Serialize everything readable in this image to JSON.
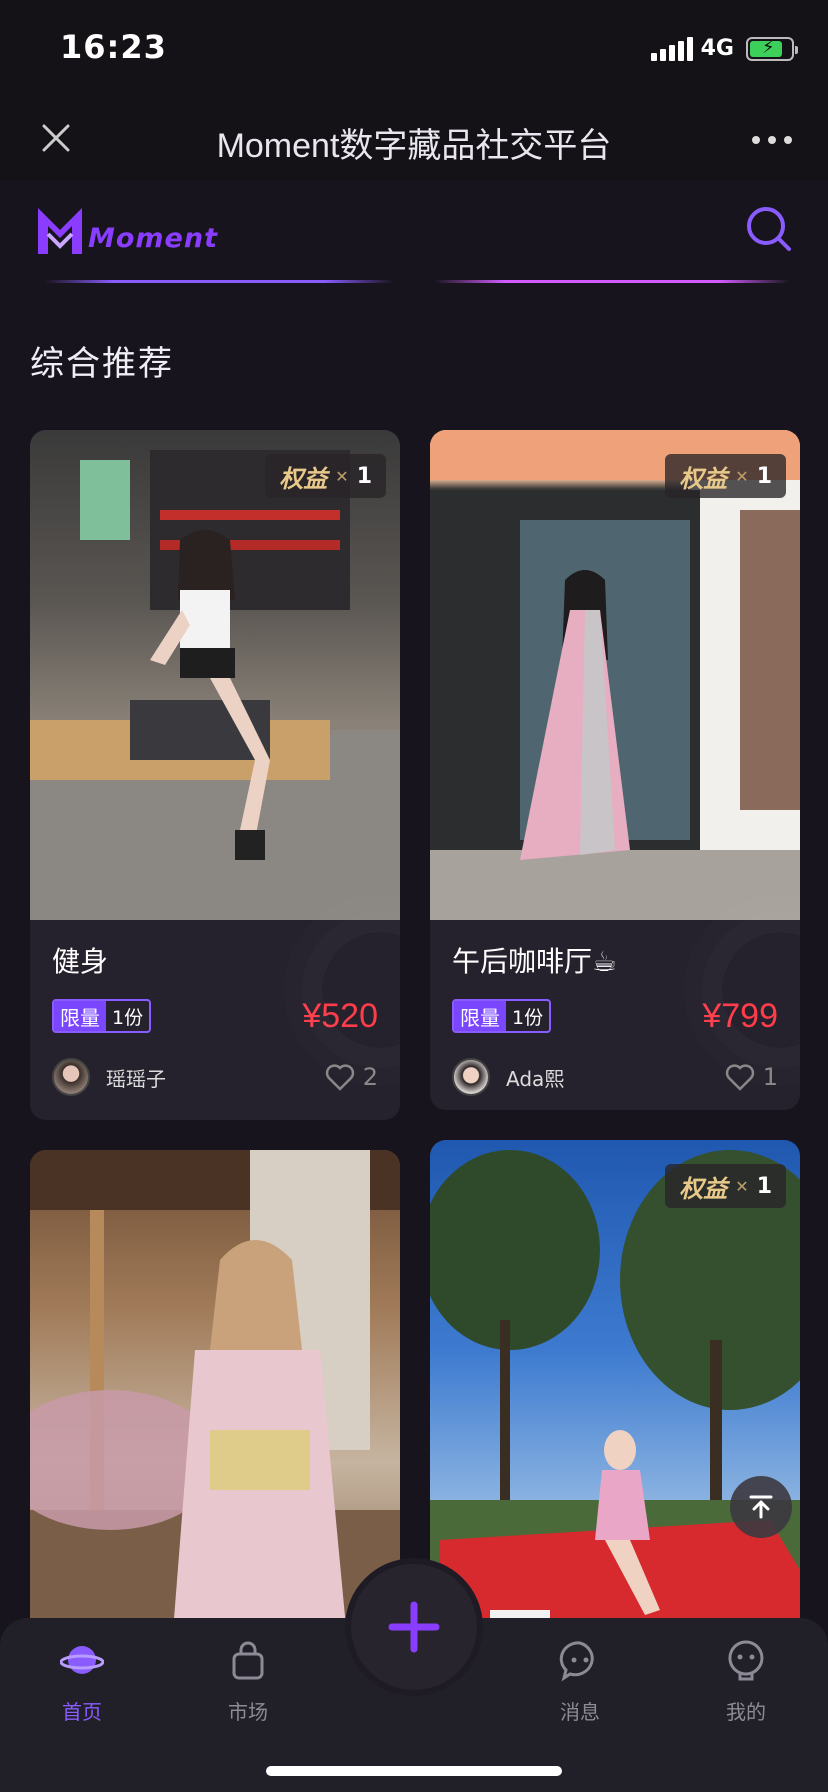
{
  "status": {
    "time": "16:23",
    "network": "4G"
  },
  "nav": {
    "title": "Moment数字藏品社交平台"
  },
  "brand": {
    "name": "Moment",
    "accent": "#8a3dff"
  },
  "section": {
    "title": "综合推荐"
  },
  "cards": [
    {
      "title": "健身",
      "limit_tag": "限量",
      "limit_qty": "1份",
      "price": "¥520",
      "owner": "瑶瑶子",
      "likes": "2",
      "rights": {
        "label": "权益",
        "count": "1"
      }
    },
    {
      "title": "午后咖啡厅☕",
      "limit_tag": "限量",
      "limit_qty": "1份",
      "price": "¥799",
      "owner": "Ada熙",
      "likes": "1",
      "rights": {
        "label": "权益",
        "count": "1"
      }
    },
    {
      "title": "",
      "rights": null
    },
    {
      "title": "",
      "rights": {
        "label": "权益",
        "count": "1"
      }
    }
  ],
  "tabs": [
    {
      "label": "首页",
      "icon": "planet-icon",
      "active": true
    },
    {
      "label": "市场",
      "icon": "bag-icon"
    },
    {
      "label": "消息",
      "icon": "chat-icon"
    },
    {
      "label": "我的",
      "icon": "profile-icon"
    }
  ],
  "colors": {
    "price": "#ff3c4a",
    "accent": "#8a5cff",
    "background": "#17141d"
  }
}
